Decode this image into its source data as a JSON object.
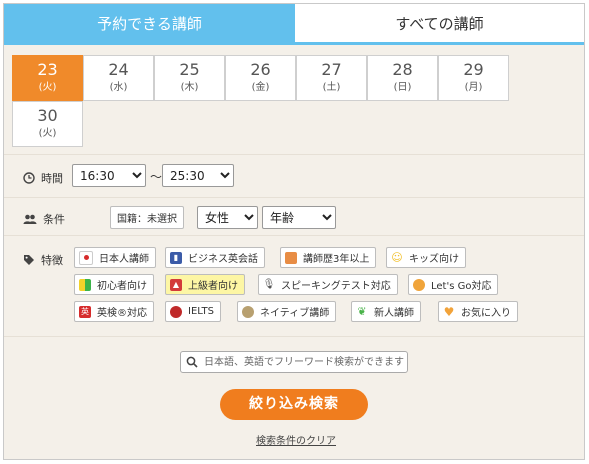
{
  "tabs": {
    "available": "予約できる講師",
    "all": "すべての講師"
  },
  "dates": [
    {
      "day": "23",
      "wd": "(火)"
    },
    {
      "day": "24",
      "wd": "(水)"
    },
    {
      "day": "25",
      "wd": "(木)"
    },
    {
      "day": "26",
      "wd": "(金)"
    },
    {
      "day": "27",
      "wd": "(土)"
    },
    {
      "day": "28",
      "wd": "(日)"
    },
    {
      "day": "29",
      "wd": "(月)"
    },
    {
      "day": "30",
      "wd": "(火)"
    }
  ],
  "time": {
    "label": "時間",
    "from": "16:30",
    "tilde": "～",
    "to": "25:30"
  },
  "conditions": {
    "label": "条件",
    "nationality": "国籍：未選択",
    "gender": "女性",
    "age": "年齢"
  },
  "features": {
    "label": "特徴",
    "chips": [
      {
        "label": "日本人講師",
        "icon": "japan-flag-icon",
        "color": "#d62b2b"
      },
      {
        "label": "ビジネス英会話",
        "icon": "business-building-icon",
        "color": "#3b5ba8"
      },
      {
        "label": "講師歴3年以上",
        "icon": "box-icon",
        "color": "#e88d45"
      },
      {
        "label": "キッズ向け",
        "icon": "smile-icon",
        "color": "#f2c02a"
      },
      {
        "label": "初心者向け",
        "icon": "beginner-mark-icon",
        "color": "#3bb34a"
      },
      {
        "label": "上級者向け",
        "icon": "graduation-cap-icon",
        "color": "#d33a3a",
        "selected": true
      },
      {
        "label": "スピーキングテスト対応",
        "icon": "microphone-icon",
        "color": "#555555"
      },
      {
        "label": "Let's Go対応",
        "icon": "letsgo-icon",
        "color": "#f0a43a"
      },
      {
        "label": "英検®対応",
        "icon": "eiken-icon",
        "color": "#d62b2b"
      },
      {
        "label": "IELTS",
        "icon": "ielts-icon",
        "color": "#c02a2a"
      },
      {
        "label": "ネイティブ講師",
        "icon": "native-person-icon",
        "color": "#b8a070"
      },
      {
        "label": "新人講師",
        "icon": "sprout-icon",
        "color": "#4ab34a"
      },
      {
        "label": "お気に入り",
        "icon": "heart-icon",
        "color": "#f2a33a"
      }
    ]
  },
  "search": {
    "placeholder": "日本語、英語でフリーワード検索ができます"
  },
  "actions": {
    "submit": "絞り込み検索",
    "clear": "検索条件のクリア"
  },
  "colors": {
    "tab_active": "#62c0ed",
    "selected_date": "#f08a2a",
    "submit": "#f07d1e"
  }
}
